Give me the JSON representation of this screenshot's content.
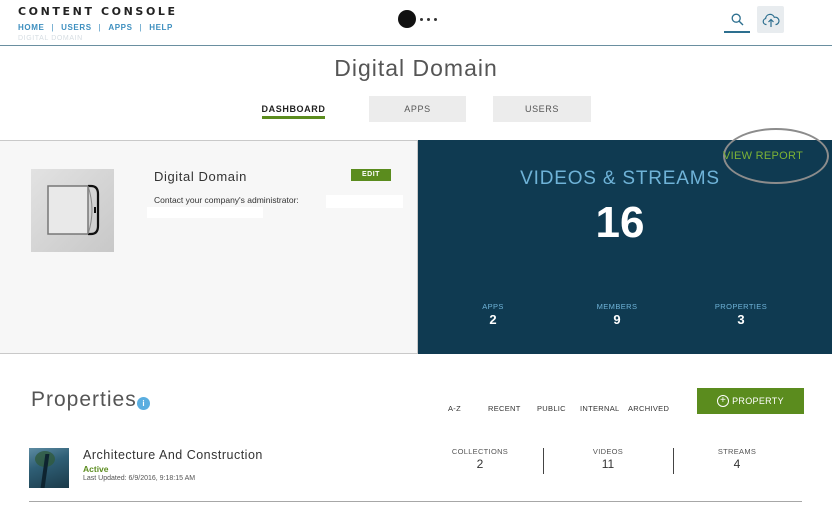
{
  "header": {
    "brand": "CONTENT CONSOLE",
    "nav": [
      "HOME",
      "USERS",
      "APPS",
      "HELP"
    ],
    "nav_separator": "|",
    "ghost_breadcrumb": "DIGITAL DOMAIN",
    "icons": {
      "search": "search-icon",
      "upload": "cloud-upload-icon",
      "logo": "brand-logo-icon"
    }
  },
  "page": {
    "title": "Digital Domain",
    "tabs": [
      {
        "label": "DASHBOARD",
        "active": true
      },
      {
        "label": "APPS",
        "active": false
      },
      {
        "label": "USERS",
        "active": false
      }
    ]
  },
  "company": {
    "name": "Digital Domain",
    "edit_label": "EDIT",
    "contact_text": "Contact your company's administrator:"
  },
  "stats": {
    "view_report_label": "VIEW REPORT",
    "headline_label": "VIDEOS & STREAMS",
    "headline_value": "16",
    "apps_label": "APPS",
    "apps_value": "2",
    "members_label": "MEMBERS",
    "members_value": "9",
    "properties_label": "PROPERTIES",
    "properties_value": "3"
  },
  "properties": {
    "title": "Properties",
    "info_icon_glyph": "i",
    "filters": [
      "A-Z",
      "RECENT",
      "PUBLIC",
      "INTERNAL",
      "ARCHIVED"
    ],
    "add_button_label": "PROPERTY",
    "add_button_icon": "plus-circle-icon",
    "items": [
      {
        "name": "Architecture And Construction",
        "status": "Active",
        "last_updated": "Last Updated: 6/9/2016, 9:18:15 AM",
        "collections_label": "COLLECTIONS",
        "collections_value": "2",
        "videos_label": "VIDEOS",
        "videos_value": "11",
        "streams_label": "STREAMS",
        "streams_value": "4"
      }
    ]
  },
  "colors": {
    "accent_green": "#5b8c1e",
    "stats_bg": "#0f3a51",
    "stats_label_blue": "#6fb3d8",
    "nav_blue": "#3d8fbf"
  }
}
